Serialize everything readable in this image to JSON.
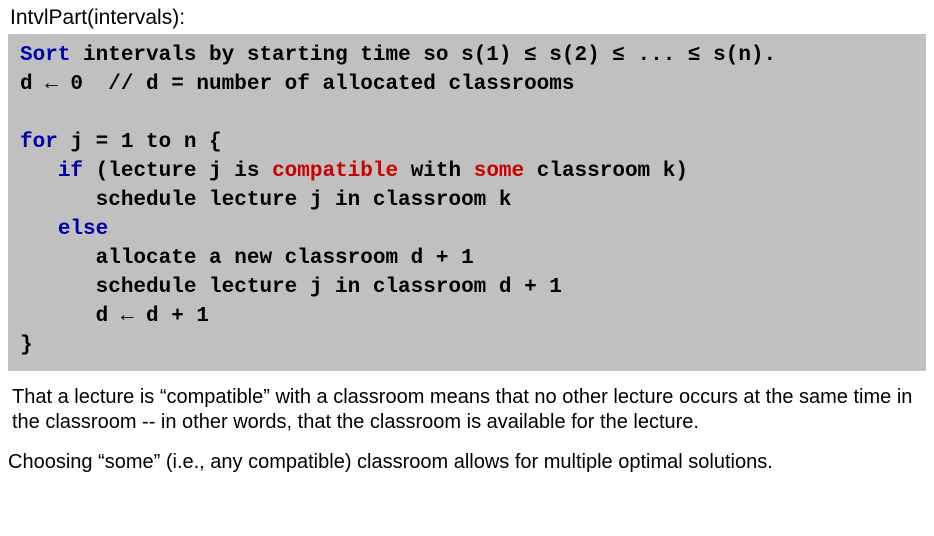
{
  "title": "IntvlPart(intervals):",
  "code": {
    "l1a": "Sort",
    "l1b": " intervals by starting time so s(1) ≤ s(2) ≤ ... ≤ s(n).",
    "l2": "d ← 0  // d = number of allocated classrooms",
    "blank1": "",
    "l3a": "for",
    "l3b": " j = 1 to n {",
    "l4a": "   ",
    "l4b": "if",
    "l4c": " (lecture j is ",
    "l4d": "compatible",
    "l4e": " with ",
    "l4f": "some",
    "l4g": " classroom k)",
    "l5": "      schedule lecture j in classroom k",
    "l6a": "   ",
    "l6b": "else",
    "l7": "      allocate a new classroom d + 1",
    "l8": "      schedule lecture j in classroom d + 1",
    "l9": "      d ← d + 1",
    "l10": "}"
  },
  "para1": "That a lecture is “compatible” with a classroom means that no other lecture occurs at the same time in the classroom -- in other words, that the classroom is available for the lecture.",
  "para2": "Choosing “some” (i.e., any compatible) classroom allows for multiple optimal solutions."
}
